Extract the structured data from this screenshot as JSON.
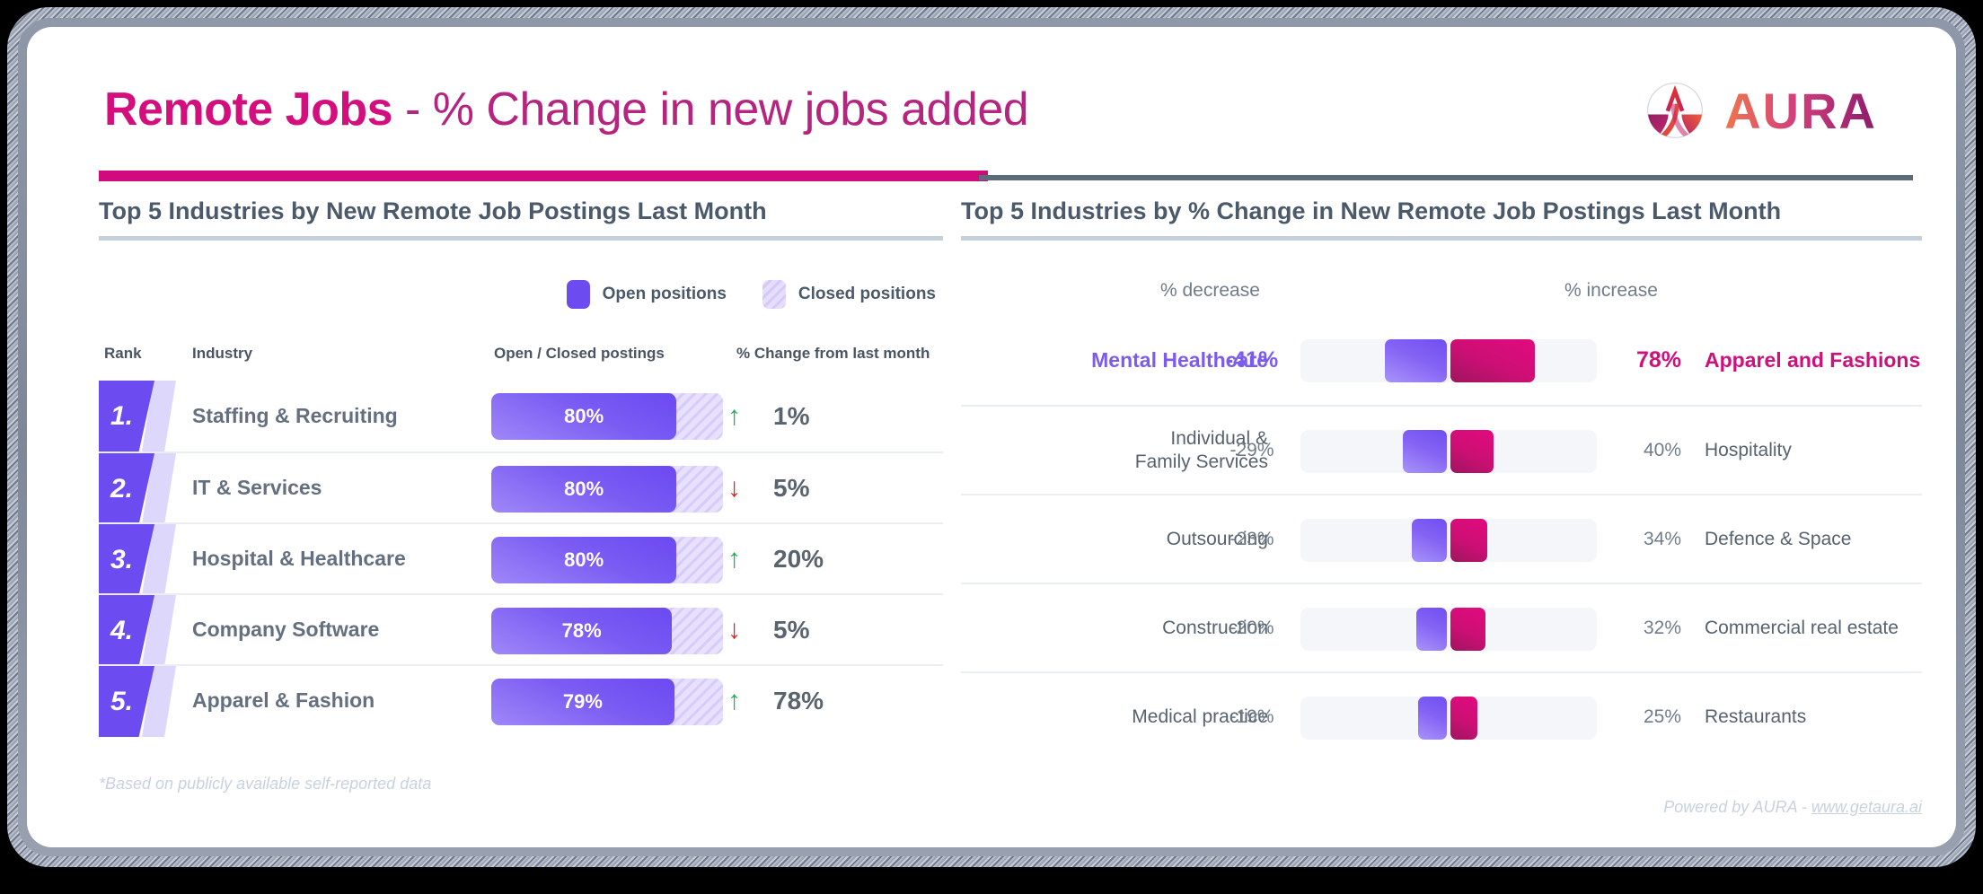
{
  "header": {
    "title_strong": "Remote Jobs",
    "title_rest": " - % Change in new jobs added",
    "logo_text": "AURA",
    "logo_mark": "aura-logo-icon",
    "accent_magenta": "#d10a7d",
    "accent_gray": "#5c6b79"
  },
  "left": {
    "panel_title": "Top 5 Industries by New Remote Job Postings Last Month",
    "legend": [
      {
        "label": "Open positions",
        "swatch": "open",
        "color": "#6c4cf1"
      },
      {
        "label": "Closed positions",
        "swatch": "closed",
        "color": "#d4c9f8"
      }
    ],
    "columns": {
      "rank": "Rank",
      "industry": "Industry",
      "bar": "Open / Closed postings",
      "change": "% Change from last month"
    },
    "rows": [
      {
        "rank": "1.",
        "industry": "Staffing & Recruiting",
        "open_pct": "80%",
        "open_value": 80,
        "direction": "up",
        "arrow": "↑",
        "change": "1%"
      },
      {
        "rank": "2.",
        "industry": "IT & Services",
        "open_pct": "80%",
        "open_value": 80,
        "direction": "down",
        "arrow": "↓",
        "change": "5%"
      },
      {
        "rank": "3.",
        "industry": "Hospital & Healthcare",
        "open_pct": "80%",
        "open_value": 80,
        "direction": "up",
        "arrow": "↑",
        "change": "20%"
      },
      {
        "rank": "4.",
        "industry": "Company Software",
        "open_pct": "78%",
        "open_value": 78,
        "direction": "down",
        "arrow": "↓",
        "change": "5%"
      },
      {
        "rank": "5.",
        "industry": "Apparel & Fashion",
        "open_pct": "79%",
        "open_value": 79,
        "direction": "up",
        "arrow": "↑",
        "change": "78%"
      }
    ],
    "footnote": "*Based on publicly available self-reported data"
  },
  "right": {
    "panel_title": "Top 5 Industries by % Change in New Remote Job Postings Last Month",
    "axis_left": "% decrease",
    "axis_right": "% increase",
    "rows": [
      {
        "left_label": "Mental Healthcare",
        "left_value": "-41%",
        "left_pct": 41,
        "right_value": "78%",
        "right_pct": 78,
        "right_label": "Apparel and Fashions",
        "highlight": true
      },
      {
        "left_label": "Individual &\nFamily Services",
        "left_value": "-29%",
        "left_pct": 29,
        "right_value": "40%",
        "right_pct": 40,
        "right_label": "Hospitality",
        "highlight": false
      },
      {
        "left_label": "Outsourcing",
        "left_value": "-23%",
        "left_pct": 23,
        "right_value": "34%",
        "right_pct": 34,
        "right_label": "Defence & Space",
        "highlight": false
      },
      {
        "left_label": "Construction",
        "left_value": "-20%",
        "left_pct": 20,
        "right_value": "32%",
        "right_pct": 32,
        "right_label": "Commercial real estate",
        "highlight": false
      },
      {
        "left_label": "Medical practice",
        "left_value": "-19%",
        "left_pct": 19,
        "right_value": "25%",
        "right_pct": 25,
        "right_label": "Restaurants",
        "highlight": false
      }
    ],
    "footnote_prefix": "Powered by AURA - ",
    "footnote_link": "www.getaura.ai"
  },
  "chart_data": [
    {
      "type": "bar",
      "title": "Top 5 Industries by New Remote Job Postings Last Month",
      "categories": [
        "Staffing & Recruiting",
        "IT & Services",
        "Hospital & Healthcare",
        "Company Software",
        "Apparel & Fashion"
      ],
      "series": [
        {
          "name": "Open positions",
          "values": [
            80,
            80,
            80,
            78,
            79
          ]
        },
        {
          "name": "Closed positions",
          "values": [
            20,
            20,
            20,
            22,
            21
          ]
        }
      ],
      "annotations": [
        "1%",
        "5%",
        "20%",
        "5%",
        "78%"
      ],
      "xlabel": "Open / Closed postings",
      "ylabel": "",
      "ylim": [
        0,
        100
      ],
      "grid": false,
      "legend": "top-right"
    },
    {
      "type": "bar",
      "title": "Top 5 Industries by % Change in New Remote Job Postings Last Month",
      "xlabel": "",
      "ylabel": "",
      "xlim": [
        -50,
        100
      ],
      "grid": false,
      "legend": "none",
      "series": [
        {
          "name": "% decrease",
          "categories": [
            "Mental Healthcare",
            "Individual & Family Services",
            "Outsourcing",
            "Construction",
            "Medical practice"
          ],
          "values": [
            -41,
            -29,
            -23,
            -20,
            -19
          ]
        },
        {
          "name": "% increase",
          "categories": [
            "Apparel and Fashions",
            "Hospitality",
            "Defence & Space",
            "Commercial real estate",
            "Restaurants"
          ],
          "values": [
            78,
            40,
            34,
            32,
            25
          ]
        }
      ]
    }
  ]
}
